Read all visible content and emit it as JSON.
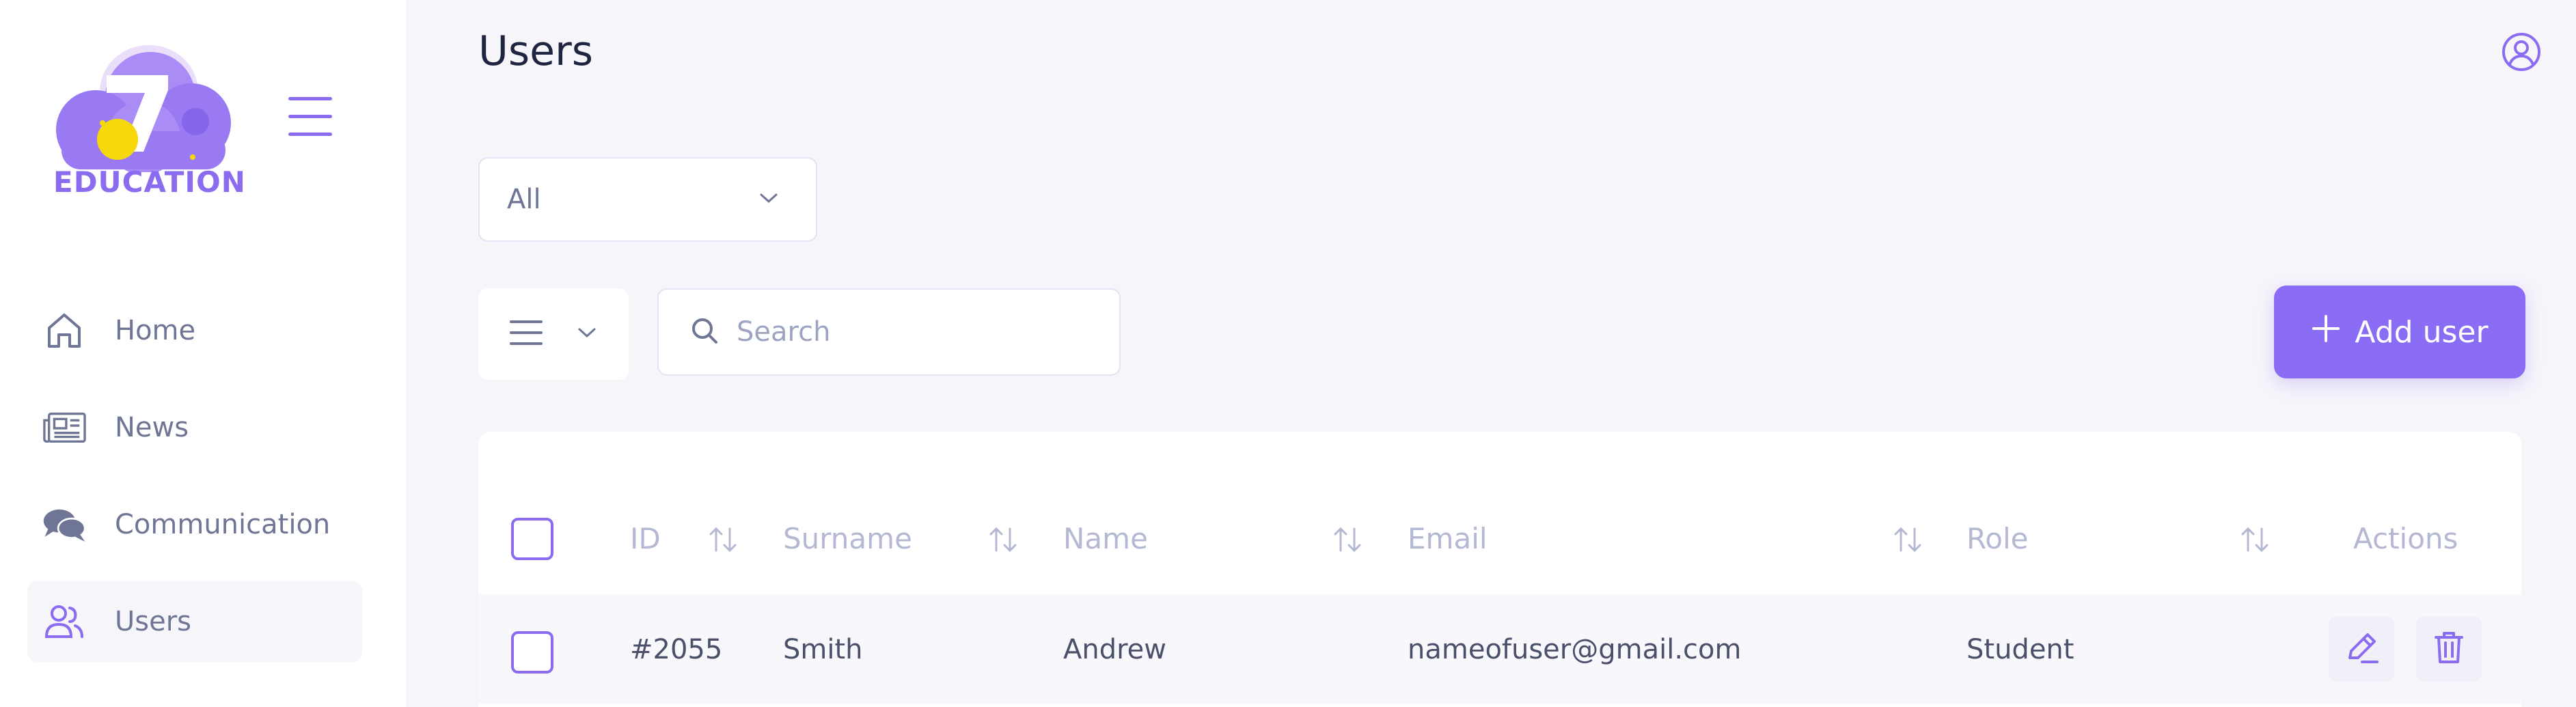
{
  "sidebar": {
    "logo_text": "EDUCATION",
    "logo_glyph": "7",
    "items": [
      {
        "label": "Home",
        "icon": "home-icon",
        "active": false
      },
      {
        "label": "News",
        "icon": "newspaper-icon",
        "active": false
      },
      {
        "label": "Communication",
        "icon": "chat-icon",
        "active": false
      },
      {
        "label": "Users",
        "icon": "users-icon",
        "active": true
      }
    ]
  },
  "header": {
    "title": "Users",
    "profile_icon": "user-circle-icon"
  },
  "filters": {
    "role_filter_value": "All",
    "search_placeholder": "Search",
    "add_user_label": "Add user"
  },
  "table": {
    "columns": [
      "ID",
      "Surname",
      "Name",
      "Email",
      "Role",
      "Actions"
    ],
    "rows": [
      {
        "id": "#2055",
        "surname": "Smith",
        "name": "Andrew",
        "email": "nameofuser@gmail.com",
        "role": "Student"
      }
    ]
  },
  "colors": {
    "accent": "#8b6cf5",
    "background": "#f5f5fa",
    "text": "#4a4f6a",
    "muted": "#b4b8d2"
  }
}
